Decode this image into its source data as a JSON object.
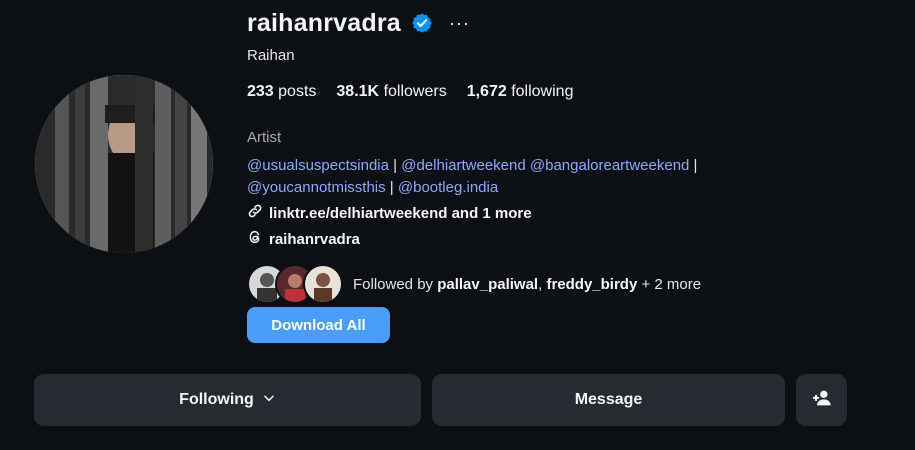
{
  "profile": {
    "username": "raihanrvadra",
    "full_name": "Raihan",
    "verified": true,
    "more_glyph": "···"
  },
  "stats": {
    "posts_count": "233",
    "posts_label": "posts",
    "followers_count": "38.1K",
    "followers_label": "followers",
    "following_count": "1,672",
    "following_label": "following"
  },
  "bio": {
    "category": "Artist",
    "mentions": [
      "@usualsuspectsindia",
      "@delhiartweekend",
      "@bangaloreartweekend",
      "@youcannotmissthis",
      "@bootleg.india"
    ],
    "separator": "|",
    "link": "linktr.ee/delhiartweekend and 1 more",
    "threads_handle": "raihanrvadra"
  },
  "followed_by": {
    "prefix": "Followed by",
    "user1": "pallav_paliwal",
    "comma": ",",
    "user2": "freddy_birdy",
    "suffix": "+ 2 more"
  },
  "buttons": {
    "download": "Download All",
    "following": "Following",
    "message": "Message"
  },
  "icons": {
    "verified": "verified-badge-icon",
    "link": "link-icon",
    "threads": "threads-icon",
    "chevron": "chevron-down-icon",
    "add_user": "add-user-icon"
  },
  "colors": {
    "background": "#0c1014",
    "accent": "#4a9df8",
    "mention": "#8fa8ff",
    "button_bg": "#262b31"
  }
}
